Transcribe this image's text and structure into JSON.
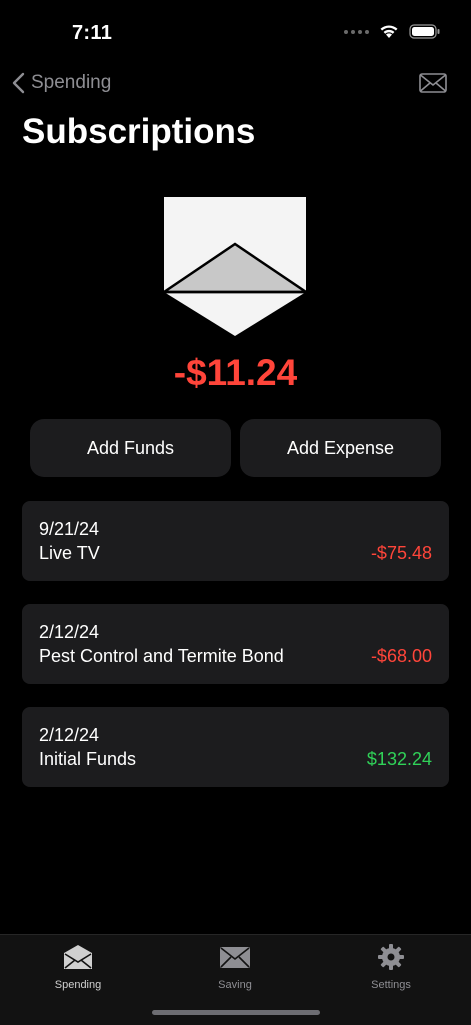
{
  "status_bar": {
    "time": "7:11"
  },
  "nav": {
    "back_label": "Spending"
  },
  "page": {
    "title": "Subscriptions"
  },
  "balance": {
    "amount": "-$11.24",
    "color": "#ff453a"
  },
  "actions": {
    "add_funds": "Add Funds",
    "add_expense": "Add Expense"
  },
  "transactions": [
    {
      "date": "9/21/24",
      "name": "Live TV",
      "amount": "-$75.48",
      "type": "expense"
    },
    {
      "date": "2/12/24",
      "name": "Pest Control and Termite Bond",
      "amount": "-$68.00",
      "type": "expense"
    },
    {
      "date": "2/12/24",
      "name": "Initial Funds",
      "amount": "$132.24",
      "type": "income"
    }
  ],
  "tabs": [
    {
      "label": "Spending",
      "icon": "envelope-open-icon",
      "active": true
    },
    {
      "label": "Saving",
      "icon": "envelope-icon",
      "active": false
    },
    {
      "label": "Settings",
      "icon": "gear-icon",
      "active": false
    }
  ],
  "colors": {
    "negative": "#ff453a",
    "positive": "#30d158",
    "card": "#1c1c1e"
  }
}
